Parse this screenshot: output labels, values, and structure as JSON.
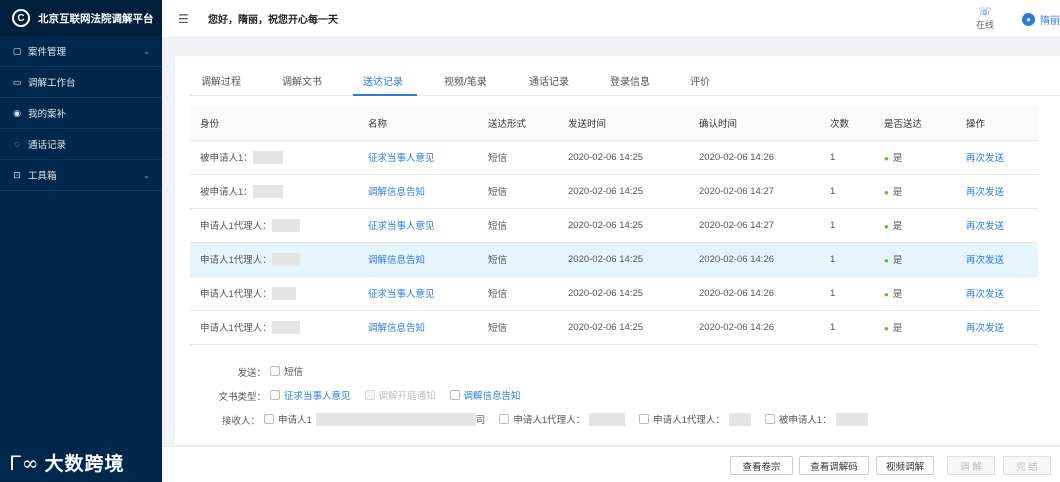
{
  "app": {
    "title": "北京互联网法院调解平台",
    "logo_glyph": "C"
  },
  "sidebar": {
    "items": [
      {
        "label": "案件管理",
        "icon": "file-icon",
        "glyph": "▢",
        "has_arrow": true
      },
      {
        "label": "调解工作台",
        "icon": "monitor-icon",
        "glyph": "▭",
        "has_arrow": false
      },
      {
        "label": "我的案补",
        "icon": "circle-dot-icon",
        "glyph": "◉",
        "has_arrow": false
      },
      {
        "label": "通话记录",
        "icon": "chat-icon",
        "glyph": "◌",
        "has_arrow": false
      },
      {
        "label": "工具箱",
        "icon": "lock-icon",
        "glyph": "⊡",
        "has_arrow": true
      }
    ],
    "arrow_glyph": "⌄",
    "footer": {
      "mark": "Ꮁ∞",
      "text": "大数跨境"
    }
  },
  "header": {
    "menu_glyph": "☰",
    "greeting": "您好，隋丽，祝您开心每一天",
    "status_glyph": "☏",
    "status": "在线",
    "avatar_glyph": "●",
    "user_name": "隋丽"
  },
  "tabs": [
    {
      "label": "调解过程",
      "active": false
    },
    {
      "label": "调解文书",
      "active": false
    },
    {
      "label": "送达记录",
      "active": true
    },
    {
      "label": "视频/笔录",
      "active": false
    },
    {
      "label": "通话记录",
      "active": false
    },
    {
      "label": "登录信息",
      "active": false
    },
    {
      "label": "评价",
      "active": false
    }
  ],
  "table": {
    "columns": [
      "身份",
      "名称",
      "送达形式",
      "发送时间",
      "确认时间",
      "次数",
      "是否送达",
      "操作"
    ],
    "rows": [
      {
        "identity": "被申请人1：",
        "name": "征求当事人意见",
        "form": "短信",
        "sent": "2020-02-06 14:25",
        "confirmed": "2020-02-06 14:26",
        "count": "1",
        "delivered": "是",
        "action": "再次发送"
      },
      {
        "identity": "被申请人1：",
        "name": "调解信息告知",
        "form": "短信",
        "sent": "2020-02-06 14:25",
        "confirmed": "2020-02-06 14:27",
        "count": "1",
        "delivered": "是",
        "action": "再次发送"
      },
      {
        "identity": "申请人1代理人：",
        "name": "征求当事人意见",
        "form": "短信",
        "sent": "2020-02-06 14:25",
        "confirmed": "2020-02-06 14:27",
        "count": "1",
        "delivered": "是",
        "action": "再次发送"
      },
      {
        "identity": "申请人1代理人：",
        "name": "调解信息告知",
        "form": "短信",
        "sent": "2020-02-06 14:25",
        "confirmed": "2020-02-06 14:26",
        "count": "1",
        "delivered": "是",
        "action": "再次发送"
      },
      {
        "identity": "申请人1代理人：",
        "name": "征求当事人意见",
        "form": "短信",
        "sent": "2020-02-06 14:25",
        "confirmed": "2020-02-06 14:26",
        "count": "1",
        "delivered": "是",
        "action": "再次发送"
      },
      {
        "identity": "申请人1代理人：",
        "name": "调解信息告知",
        "form": "短信",
        "sent": "2020-02-06 14:25",
        "confirmed": "2020-02-06 14:26",
        "count": "1",
        "delivered": "是",
        "action": "再次发送"
      }
    ],
    "highlighted_row": 3,
    "status_color": "#52c41a"
  },
  "send_form": {
    "send_label": "发送：",
    "send_options": [
      "短信"
    ],
    "doc_type_label": "文书类型：",
    "doc_types": [
      {
        "label": "征求当事人意见",
        "disabled": false
      },
      {
        "label": "调解开庭通知",
        "disabled": true
      },
      {
        "label": "调解信息告知",
        "disabled": false
      }
    ],
    "recipient_label": "接收人：",
    "recipients": [
      {
        "label": "申请人1",
        "tail": "司"
      },
      {
        "label": "申请人1代理人：",
        "tail": ""
      },
      {
        "label": "申请人1代理人：",
        "tail": ""
      },
      {
        "label": "被申请人1：",
        "tail": ""
      }
    ]
  },
  "footer_buttons": [
    {
      "label": "查看卷宗",
      "disabled": false
    },
    {
      "label": "查看调解码",
      "disabled": false
    },
    {
      "label": "视频调解",
      "disabled": false
    },
    {
      "label": "调 解",
      "disabled": true
    },
    {
      "label": "完 结",
      "disabled": true
    }
  ],
  "colors": {
    "sidebar_bg": "#00284d",
    "accent": "#2b7be0",
    "row_highlight": "#e6f4fc"
  }
}
